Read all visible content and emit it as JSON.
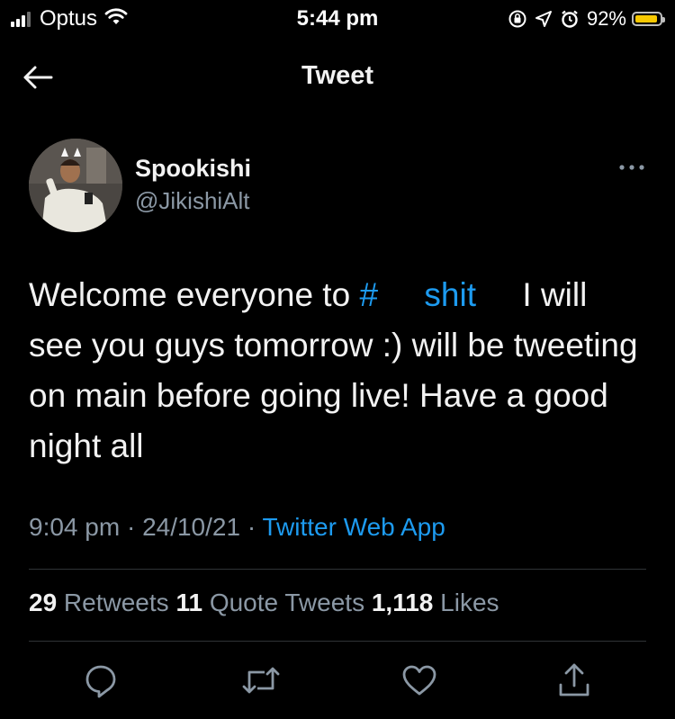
{
  "status_bar": {
    "carrier": "Optus",
    "time": "5:44 pm",
    "battery_percent": "92%",
    "battery_level": 0.92
  },
  "header": {
    "title": "Tweet"
  },
  "author": {
    "display_name": "Spookishi",
    "handle": "@JikishiAlt"
  },
  "tweet": {
    "text_before": "Welcome everyone to ",
    "hashtag": "#     shit",
    "text_after": "     I will see you guys tomorrow :) will be tweeting on main before going live! Have a good night all",
    "time": "9:04 pm",
    "separator": " · ",
    "date": "24/10/21",
    "source": "Twitter Web App"
  },
  "stats": {
    "retweets": "29",
    "retweets_label": " Retweets ",
    "quote_tweets": "11",
    "quote_tweets_label": " Quote Tweets ",
    "likes": "1,118",
    "likes_label": " Likes"
  },
  "colors": {
    "background": "#000000",
    "text": "#f2f2f2",
    "secondary": "#8b98a5",
    "link": "#1d9bf0",
    "divider": "#2f3336"
  },
  "icons": {
    "back": "arrow-left-icon",
    "more": "more-icon",
    "reply": "reply-icon",
    "retweet": "retweet-icon",
    "like": "heart-icon",
    "share": "share-icon"
  }
}
